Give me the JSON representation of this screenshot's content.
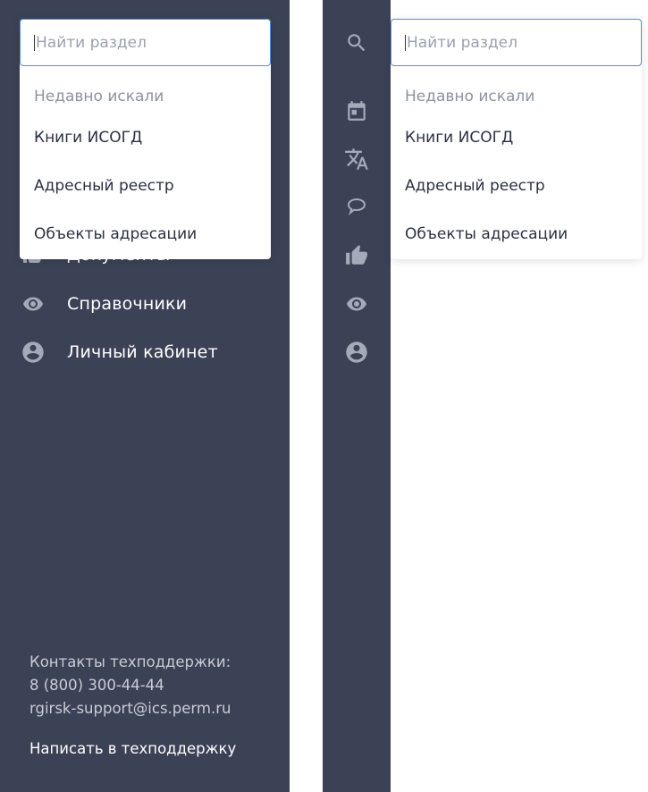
{
  "search": {
    "placeholder": "Найти раздел",
    "recent_heading": "Недавно искали",
    "recent_items": [
      "Книги ИСОГД",
      "Адресный реестр",
      "Объекты адресации"
    ]
  },
  "nav": {
    "items": [
      {
        "label": "Документы",
        "icon": "thumb-up-icon"
      },
      {
        "label": "Справочники",
        "icon": "eye-icon"
      },
      {
        "label": "Личный кабинет",
        "icon": "account-icon"
      }
    ]
  },
  "rail": {
    "icons": [
      "search-icon",
      "calendar-icon",
      "translate-icon",
      "comment-icon",
      "thumb-up-icon",
      "eye-icon",
      "account-icon"
    ]
  },
  "footer": {
    "contacts_label": "Контакты техподдержки:",
    "phone": "8 (800) 300-44-44",
    "email": "rgirsk-support@ics.perm.ru",
    "support_link": "Написать в техподдержку"
  },
  "colors": {
    "sidebar_bg": "#3c4256",
    "icon": "#a3aab8",
    "accent": "#4a90e2"
  }
}
